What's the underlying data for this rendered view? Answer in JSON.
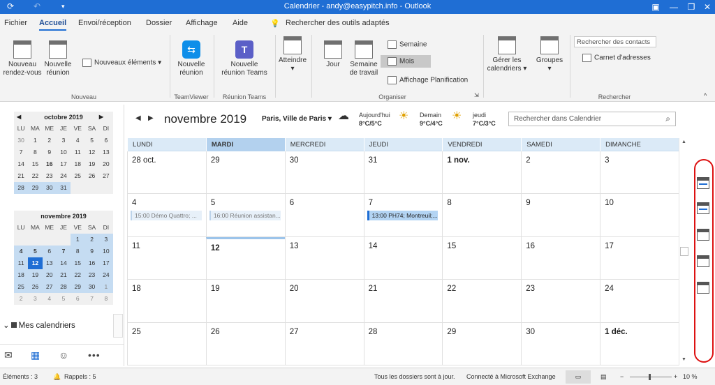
{
  "window": {
    "title": "Calendrier - andy@easypitch.info - Outlook",
    "color": "#1f6ed4"
  },
  "menu": {
    "tabs": [
      "Fichier",
      "Accueil",
      "Envoi/réception",
      "Dossier",
      "Affichage",
      "Aide"
    ],
    "active": "Accueil",
    "search_tools": "Rechercher des outils adaptés"
  },
  "ribbon": {
    "new_appointment": "Nouveau rendez-vous",
    "new_meeting": "Nouvelle réunion",
    "new_items": "Nouveaux éléments",
    "group_new": "Nouveau",
    "teamviewer_meeting": "Nouvelle réunion",
    "group_teamviewer": "TeamViewer",
    "teams_meeting": "Nouvelle réunion Teams",
    "group_teams": "Réunion Teams",
    "goto": "Atteindre",
    "day": "Jour",
    "work_week": "Semaine de travail",
    "week": "Semaine",
    "month": "Mois",
    "schedule_view": "Affichage Planification",
    "group_organize": "Organiser",
    "manage_calendars": "Gérer les calendriers",
    "groups": "Groupes",
    "contact_search_placeholder": "Rechercher des contacts",
    "address_book": "Carnet d'adresses",
    "group_search": "Rechercher"
  },
  "mini_calendars": [
    {
      "title": "octobre 2019",
      "dow": [
        "LU",
        "MA",
        "ME",
        "JE",
        "VE",
        "SA",
        "DI"
      ],
      "weeks": [
        [
          "30",
          "1",
          "2",
          "3",
          "4",
          "5",
          "6"
        ],
        [
          "7",
          "8",
          "9",
          "10",
          "11",
          "12",
          "13"
        ],
        [
          "14",
          "15",
          "16",
          "17",
          "18",
          "19",
          "20"
        ],
        [
          "21",
          "22",
          "23",
          "24",
          "25",
          "26",
          "27"
        ],
        [
          "28",
          "29",
          "30",
          "31",
          "",
          "",
          ""
        ]
      ]
    },
    {
      "title": "novembre 2019",
      "dow": [
        "LU",
        "MA",
        "ME",
        "JE",
        "VE",
        "SA",
        "DI"
      ],
      "weeks": [
        [
          "",
          "",
          "",
          "",
          "1",
          "2",
          "3"
        ],
        [
          "4",
          "5",
          "6",
          "7",
          "8",
          "9",
          "10"
        ],
        [
          "11",
          "12",
          "13",
          "14",
          "15",
          "16",
          "17"
        ],
        [
          "18",
          "19",
          "20",
          "21",
          "22",
          "23",
          "24"
        ],
        [
          "25",
          "26",
          "27",
          "28",
          "29",
          "30",
          "1"
        ],
        [
          "2",
          "3",
          "4",
          "5",
          "6",
          "7",
          "8"
        ]
      ]
    }
  ],
  "folders": {
    "my_calendars": "Mes calendriers"
  },
  "calendar": {
    "month_title": "novembre 2019",
    "location": "Paris, Ville de Paris",
    "weather": [
      {
        "day": "Aujourd'hui",
        "temp": "8°C/5°C",
        "icon": "cloud-icon"
      },
      {
        "day": "Demain",
        "temp": "9°C/4°C",
        "icon": "partly-sunny-icon"
      },
      {
        "day": "jeudi",
        "temp": "7°C/3°C",
        "icon": "partly-sunny-icon"
      }
    ],
    "search_placeholder": "Rechercher dans Calendrier",
    "day_names": [
      "LUNDI",
      "MARDI",
      "MERCREDI",
      "JEUDI",
      "VENDREDI",
      "SAMEDI",
      "DIMANCHE"
    ],
    "current_day_index": 1,
    "weeks": [
      [
        "28 oct.",
        "29",
        "30",
        "31",
        "1 nov.",
        "2",
        "3"
      ],
      [
        "4",
        "5",
        "6",
        "7",
        "8",
        "9",
        "10"
      ],
      [
        "11",
        "12",
        "13",
        "14",
        "15",
        "16",
        "17"
      ],
      [
        "18",
        "19",
        "20",
        "21",
        "22",
        "23",
        "24"
      ],
      [
        "25",
        "26",
        "27",
        "28",
        "29",
        "30",
        "1 déc."
      ]
    ],
    "events": [
      {
        "week": 1,
        "day": 0,
        "text": "15:00 Démo Quattro; ...",
        "active": false
      },
      {
        "week": 1,
        "day": 1,
        "text": "16:00 Réunion assistan...",
        "active": false
      },
      {
        "week": 1,
        "day": 3,
        "text": "13:00 PH74; Montreuil;...",
        "active": true
      }
    ]
  },
  "status": {
    "items": "Éléments : 3",
    "reminders": "Rappels : 5",
    "folders_up_to_date": "Tous les dossiers sont à jour.",
    "connected": "Connecté à Microsoft Exchange",
    "zoom": "10 %"
  }
}
